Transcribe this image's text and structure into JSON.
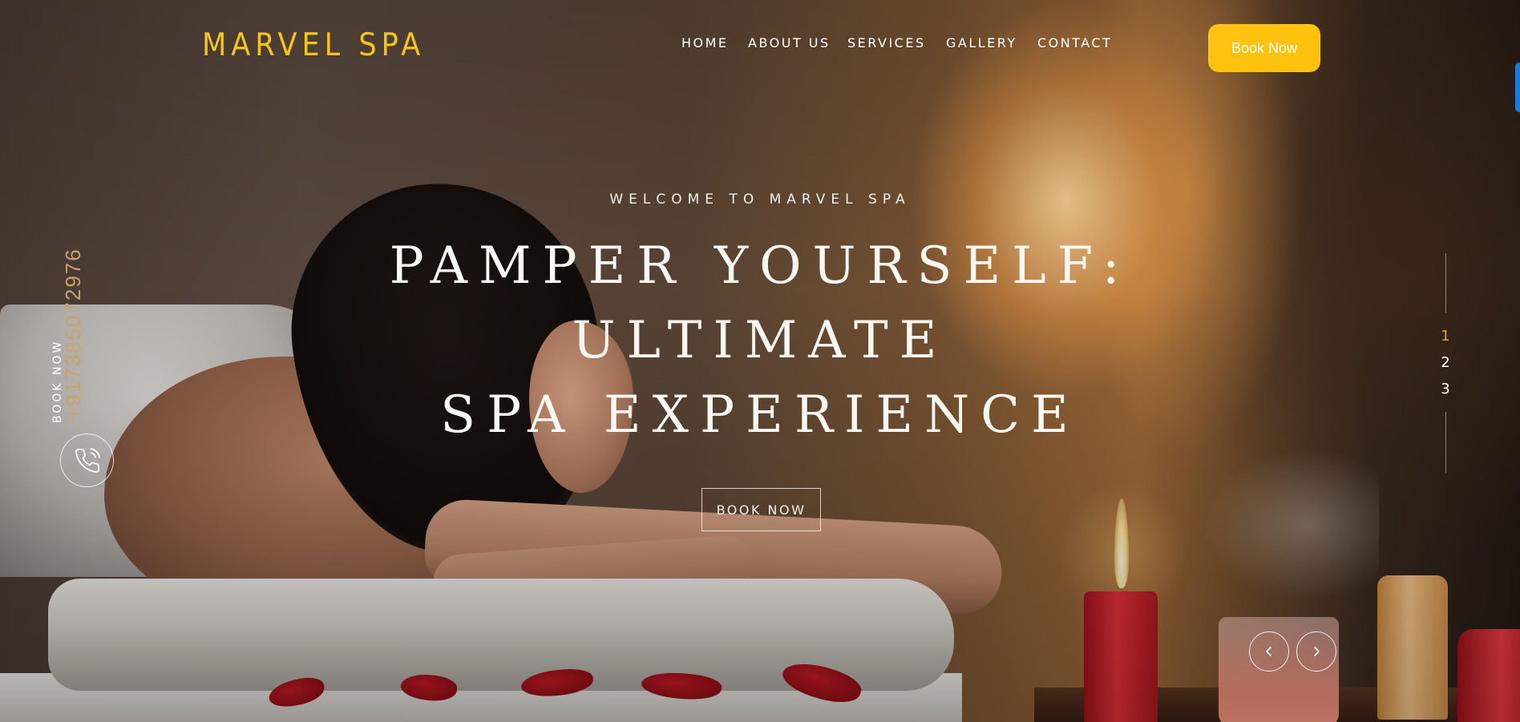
{
  "brand": {
    "logo_text": "MARVEL SPA",
    "accent_color": "#fec20f",
    "phone_accent_color": "#c8a26a"
  },
  "nav": {
    "items": [
      {
        "label": "HOME"
      },
      {
        "label": "ABOUT US"
      },
      {
        "label": "SERVICES"
      },
      {
        "label": "GALLERY"
      },
      {
        "label": "CONTACT"
      }
    ],
    "cta_label": "Book Now"
  },
  "hero": {
    "welcome": "WELCOME TO MARVEL SPA",
    "headline_lines": [
      "PAMPER YOURSELF:",
      "ULTIMATE",
      "SPA EXPERIENCE"
    ],
    "cta_label": "BOOK NOW",
    "background_image": "spa massage scene with woman resting on towel, candles"
  },
  "side": {
    "book_label": "BOOK NOW",
    "phone": "+917385072976",
    "phone_icon": "phone-icon"
  },
  "slider": {
    "pages": [
      "1",
      "2",
      "3"
    ],
    "active_page": 1,
    "prev_icon": "chevron-left-icon",
    "next_icon": "chevron-right-icon"
  }
}
